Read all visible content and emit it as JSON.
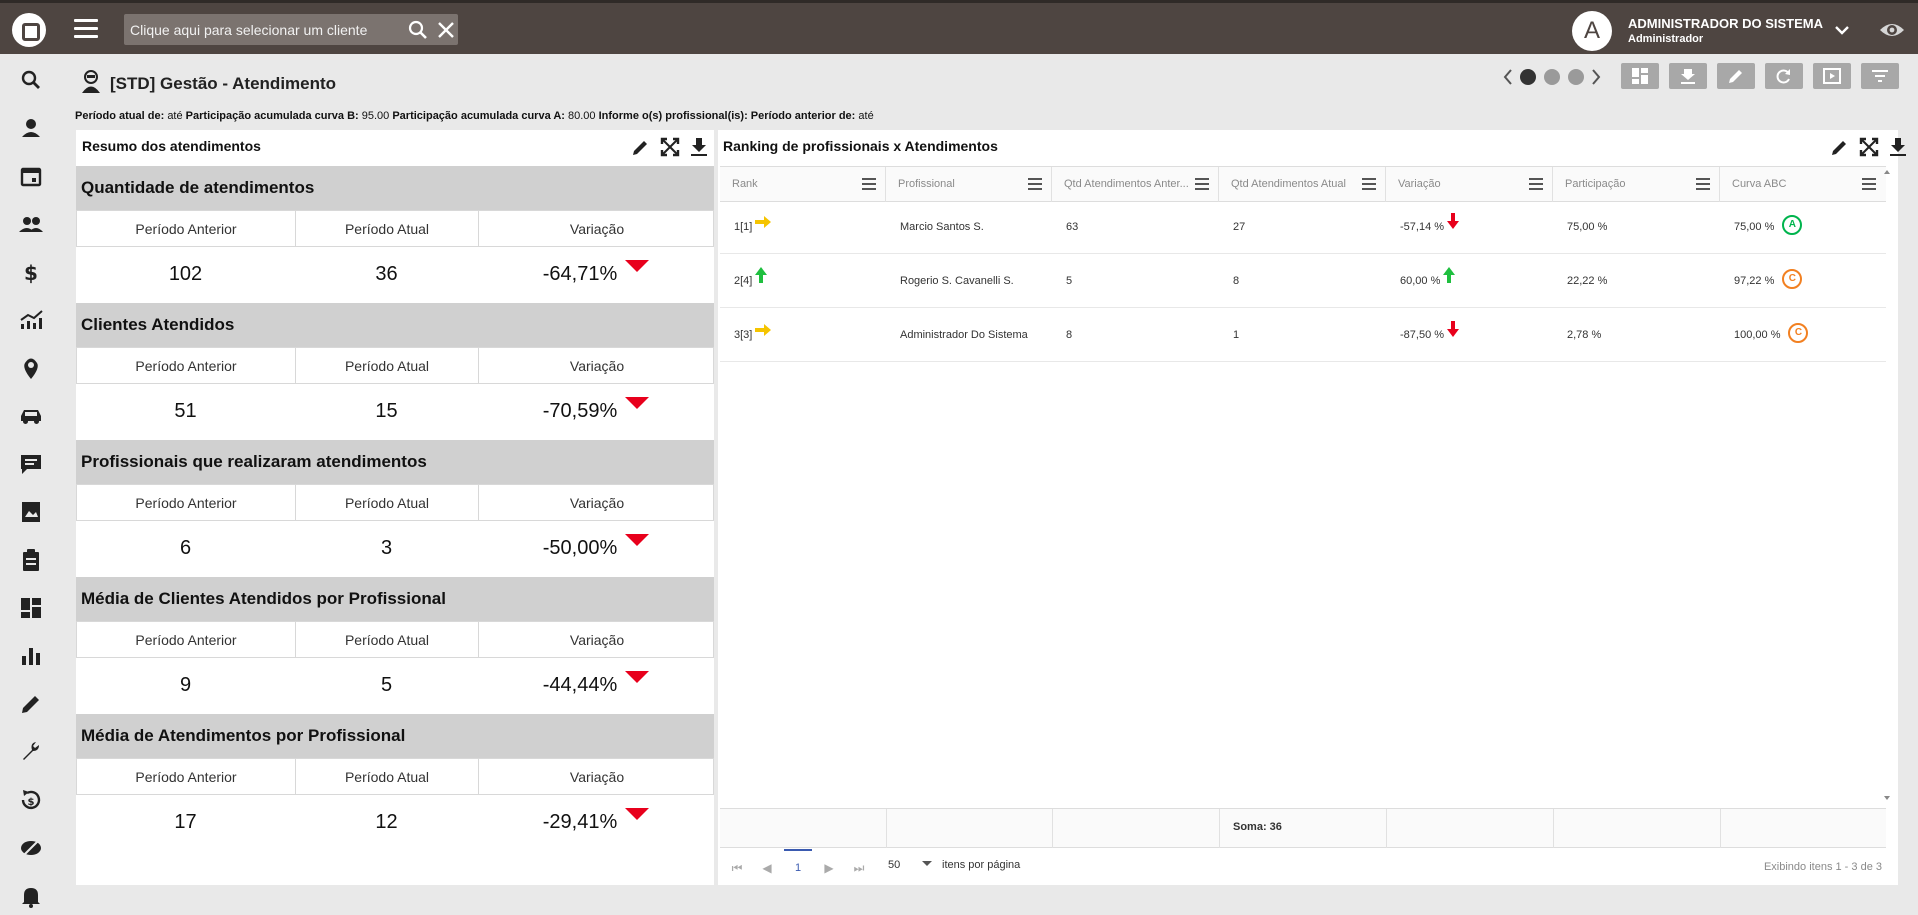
{
  "topbar": {
    "client_placeholder": "Clique aqui para selecionar um cliente",
    "user_initial": "A",
    "user_name": "ADMINISTRADOR DO SISTEMA",
    "user_role": "Administrador"
  },
  "sidebar": {
    "items": [
      "search-icon",
      "user-icon",
      "calendar-icon",
      "group-icon",
      "dollar-icon",
      "trend-icon",
      "location-pin-icon",
      "car-icon",
      "chat-icon",
      "photo-book-icon",
      "clipboard-icon",
      "dashboard-icon",
      "bar-chart-icon",
      "pencil-icon",
      "wrench-icon",
      "money-history-icon",
      "eye-off-icon",
      "bell-icon"
    ]
  },
  "header": {
    "title": "[STD] Gestão - Atendimento",
    "filters": [
      {
        "label": "Período atual de:",
        "value": "até"
      },
      {
        "label": "Participação acumulada curva B:",
        "value": "95.00"
      },
      {
        "label": "Participação acumulada curva A:",
        "value": "80.00"
      },
      {
        "label": "Informe o(s) profissional(is):",
        "value": ""
      },
      {
        "label": "Período anterior de:",
        "value": "até"
      }
    ]
  },
  "summary": {
    "title": "Resumo dos atendimentos",
    "col_prev": "Período Anterior",
    "col_curr": "Período Atual",
    "col_var": "Variação",
    "sections": [
      {
        "title": "Quantidade de atendimentos",
        "prev": "102",
        "curr": "36",
        "var": "-64,71%"
      },
      {
        "title": "Clientes Atendidos",
        "prev": "51",
        "curr": "15",
        "var": "-70,59%"
      },
      {
        "title": "Profissionais que realizaram atendimentos",
        "prev": "6",
        "curr": "3",
        "var": "-50,00%"
      },
      {
        "title": "Média de Clientes Atendidos por Profissional",
        "prev": "9",
        "curr": "5",
        "var": "-44,44%"
      },
      {
        "title": "Média de Atendimentos por Profissional",
        "prev": "17",
        "curr": "12",
        "var": "-29,41%"
      }
    ]
  },
  "ranking": {
    "title": "Ranking de profissionais x Atendimentos",
    "columns": [
      "Rank",
      "Profissional",
      "Qtd Atendimentos Anter...",
      "Qtd Atendimentos Atual",
      "Variação",
      "Participação",
      "Curva ABC"
    ],
    "rows": [
      {
        "rank": "1[1]",
        "trend": "same",
        "name": "Marcio Santos S.",
        "prev": "63",
        "curr": "27",
        "var": "-57,14 %",
        "var_dir": "down",
        "part": "75,00 %",
        "abc_pct": "75,00 %",
        "abc": "A"
      },
      {
        "rank": "2[4]",
        "trend": "up",
        "name": "Rogerio S. Cavanelli S.",
        "prev": "5",
        "curr": "8",
        "var": "60,00 %",
        "var_dir": "up",
        "part": "22,22 %",
        "abc_pct": "97,22 %",
        "abc": "C"
      },
      {
        "rank": "3[3]",
        "trend": "same",
        "name": "Administrador Do Sistema",
        "prev": "8",
        "curr": "1",
        "var": "-87,50 %",
        "var_dir": "down",
        "part": "2,78 %",
        "abc_pct": "100,00 %",
        "abc": "C"
      }
    ],
    "sum_label": "Soma: 36",
    "page_current": "1",
    "page_size": "50",
    "page_size_label": "itens por página",
    "showing": "Exibindo itens 1 - 3 de 3"
  },
  "colors": {
    "topbar": "#4e4541",
    "down": "#e8001c",
    "up": "#1fbf3f",
    "same": "#f5c400",
    "abc_a": "#00b44d",
    "abc_c": "#f28021"
  }
}
